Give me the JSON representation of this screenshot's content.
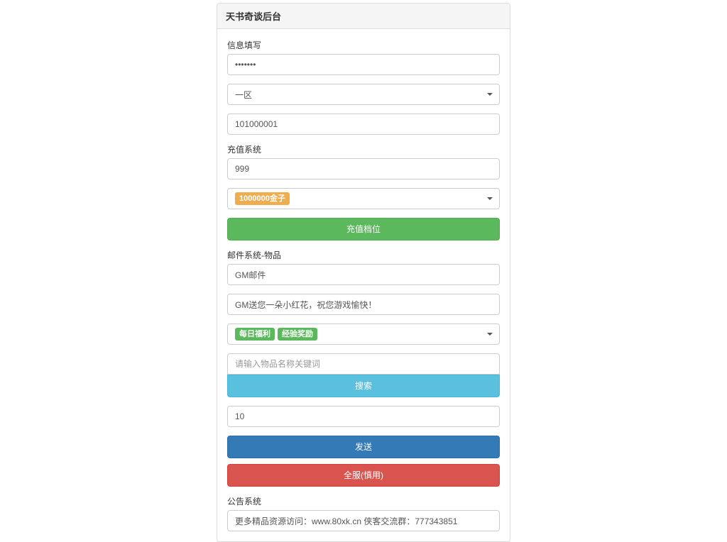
{
  "header": {
    "title": "天书奇谈后台"
  },
  "info_section": {
    "label": "信息填写",
    "password_value": "•••••••",
    "zone_selected": "一区",
    "role_id_value": "101000001"
  },
  "recharge_section": {
    "label": "充值系统",
    "amount_value": "999",
    "item_selected_badge": "1000000金子",
    "submit_label": "充值档位"
  },
  "mail_section": {
    "label": "邮件系统-物品",
    "title_value": "GM邮件",
    "content_value": "GM送您一朵小红花，祝您游戏愉快！",
    "tag_badges": [
      "每日福利",
      "经验奖励"
    ],
    "search_placeholder": "请输入物品名称关键词",
    "search_btn": "搜索",
    "qty_value": "10",
    "send_btn": "发送",
    "allserver_btn": "全服(慎用)"
  },
  "notice_section": {
    "label": "公告系统",
    "content_value": "更多精品资源访问：www.80xk.cn 侠客交流群：777343851"
  }
}
